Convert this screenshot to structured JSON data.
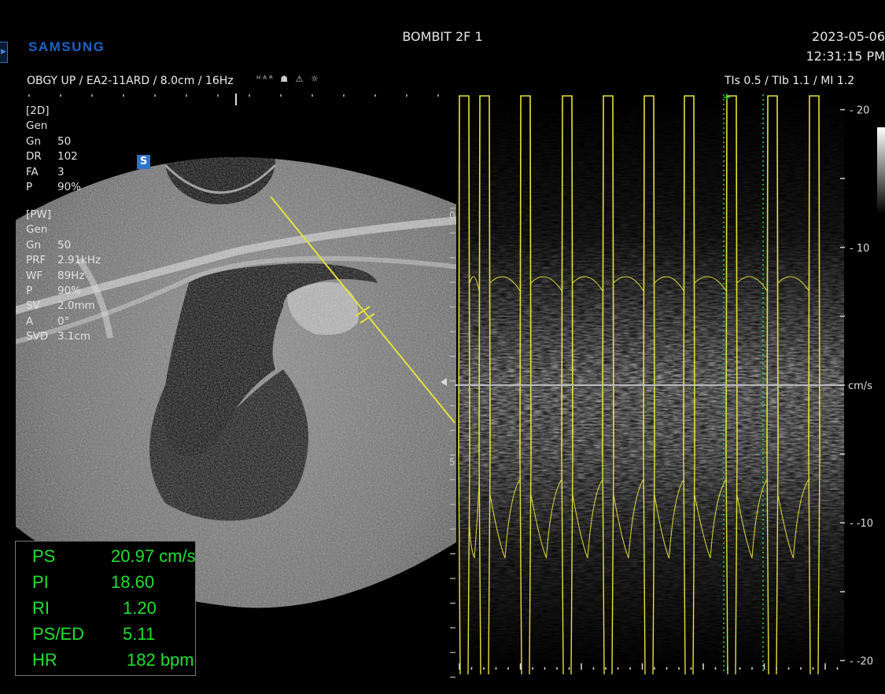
{
  "header": {
    "brand": "SAMSUNG",
    "patient_name": "BOMBIT 2F 1",
    "date": "2023-05-06",
    "time": "12:31:15 PM",
    "probe_info": "OBGY UP / EA2-11ARD / 8.0cm / 16Hz",
    "ti_info": "TIs  0.5 / TIb  1.1 / MI   1.2"
  },
  "params_2d": [
    {
      "k": "[2D]",
      "v": ""
    },
    {
      "k": "Gen",
      "v": ""
    },
    {
      "k": "Gn",
      "v": "50"
    },
    {
      "k": "DR",
      "v": "102"
    },
    {
      "k": "FA",
      "v": "3"
    },
    {
      "k": "P",
      "v": "90%"
    }
  ],
  "params_pw": [
    {
      "k": "[PW]",
      "v": ""
    },
    {
      "k": "Gen",
      "v": ""
    },
    {
      "k": "Gn",
      "v": "50"
    },
    {
      "k": "PRF",
      "v": "2.91kHz"
    },
    {
      "k": "WF",
      "v": "89Hz"
    },
    {
      "k": "P",
      "v": "90%"
    },
    {
      "k": "SV",
      "v": "2.0mm"
    },
    {
      "k": "A",
      "v": "0°"
    },
    {
      "k": "SVD",
      "v": "3.1cm"
    }
  ],
  "s_badge": "S",
  "bmode_depth_labels": {
    "top": "0",
    "mid": "5"
  },
  "velocity_scale": {
    "unit": "cm/s",
    "ticks": [
      {
        "label": "20",
        "value": 20
      },
      {
        "label": "10",
        "value": 10
      },
      {
        "label": "-10",
        "value": -10
      },
      {
        "label": "-20",
        "value": -20
      }
    ],
    "range": [
      -21,
      21
    ]
  },
  "measurements": [
    {
      "label": "PS",
      "value": "20.97 cm/s"
    },
    {
      "label": "PI",
      "value": "18.60"
    },
    {
      "label": "RI",
      "value": "1.20"
    },
    {
      "label": "PS/ED",
      "value": "5.11"
    },
    {
      "label": "HR",
      "value": "182 bpm"
    }
  ],
  "colors": {
    "brand": "#1a63c9",
    "measure_text": "#20e030",
    "trace": "#e6e23a",
    "caliper": "#22dd44"
  }
}
